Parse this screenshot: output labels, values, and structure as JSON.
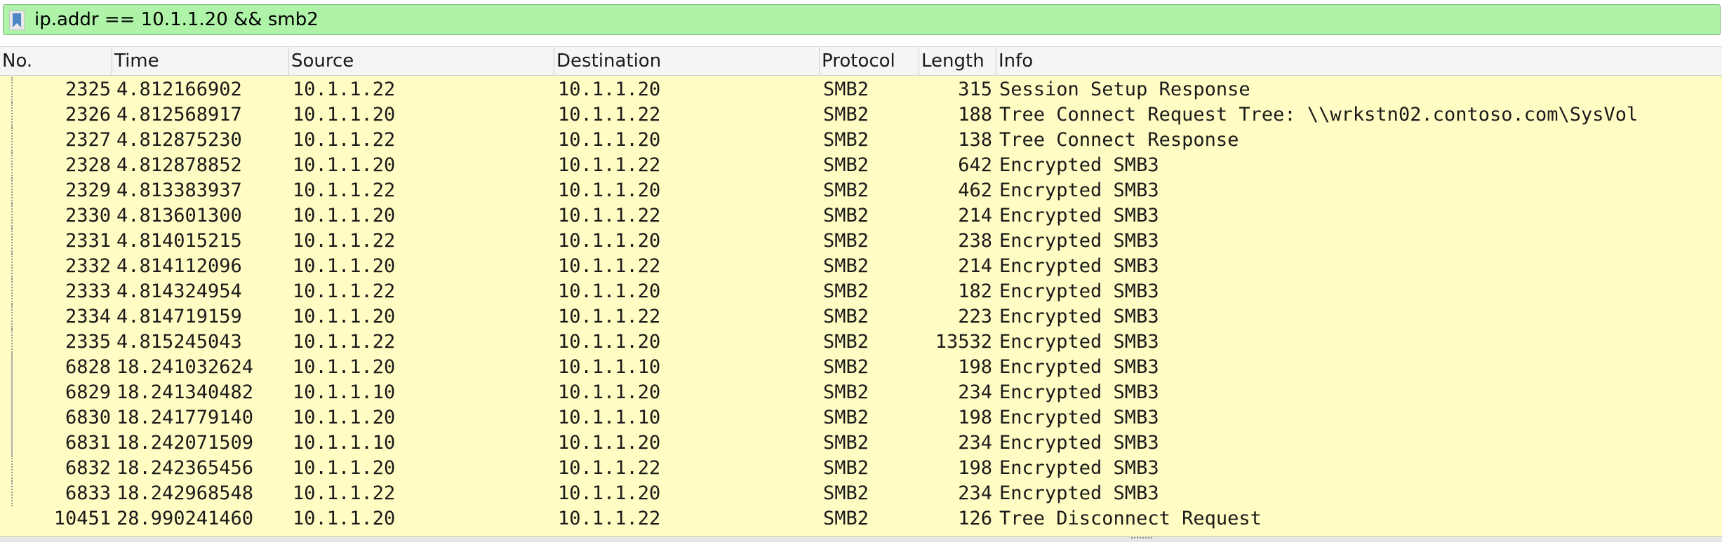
{
  "filter": {
    "value": "ip.addr == 10.1.1.20 && smb2",
    "bookmark_icon": "bookmark-icon",
    "background_color": "#aff3a8"
  },
  "columns": {
    "no": "No.",
    "time": "Time",
    "source": "Source",
    "destination": "Destination",
    "protocol": "Protocol",
    "length": "Length",
    "info": "Info"
  },
  "packets": [
    {
      "no": "2325",
      "time": "4.812166902",
      "source": "10.1.1.22",
      "destination": "10.1.1.20",
      "protocol": "SMB2",
      "length": "315",
      "info": "Session Setup Response"
    },
    {
      "no": "2326",
      "time": "4.812568917",
      "source": "10.1.1.20",
      "destination": "10.1.1.22",
      "protocol": "SMB2",
      "length": "188",
      "info": "Tree Connect Request Tree: \\\\wrkstn02.contoso.com\\SysVol"
    },
    {
      "no": "2327",
      "time": "4.812875230",
      "source": "10.1.1.22",
      "destination": "10.1.1.20",
      "protocol": "SMB2",
      "length": "138",
      "info": "Tree Connect Response"
    },
    {
      "no": "2328",
      "time": "4.812878852",
      "source": "10.1.1.20",
      "destination": "10.1.1.22",
      "protocol": "SMB2",
      "length": "642",
      "info": "Encrypted SMB3"
    },
    {
      "no": "2329",
      "time": "4.813383937",
      "source": "10.1.1.22",
      "destination": "10.1.1.20",
      "protocol": "SMB2",
      "length": "462",
      "info": "Encrypted SMB3"
    },
    {
      "no": "2330",
      "time": "4.813601300",
      "source": "10.1.1.20",
      "destination": "10.1.1.22",
      "protocol": "SMB2",
      "length": "214",
      "info": "Encrypted SMB3"
    },
    {
      "no": "2331",
      "time": "4.814015215",
      "source": "10.1.1.22",
      "destination": "10.1.1.20",
      "protocol": "SMB2",
      "length": "238",
      "info": "Encrypted SMB3"
    },
    {
      "no": "2332",
      "time": "4.814112096",
      "source": "10.1.1.20",
      "destination": "10.1.1.22",
      "protocol": "SMB2",
      "length": "214",
      "info": "Encrypted SMB3"
    },
    {
      "no": "2333",
      "time": "4.814324954",
      "source": "10.1.1.22",
      "destination": "10.1.1.20",
      "protocol": "SMB2",
      "length": "182",
      "info": "Encrypted SMB3"
    },
    {
      "no": "2334",
      "time": "4.814719159",
      "source": "10.1.1.20",
      "destination": "10.1.1.22",
      "protocol": "SMB2",
      "length": "223",
      "info": "Encrypted SMB3"
    },
    {
      "no": "2335",
      "time": "4.815245043",
      "source": "10.1.1.22",
      "destination": "10.1.1.20",
      "protocol": "SMB2",
      "length": "13532",
      "info": "Encrypted SMB3"
    },
    {
      "no": "6828",
      "time": "18.241032624",
      "source": "10.1.1.20",
      "destination": "10.1.1.10",
      "protocol": "SMB2",
      "length": "198",
      "info": "Encrypted SMB3"
    },
    {
      "no": "6829",
      "time": "18.241340482",
      "source": "10.1.1.10",
      "destination": "10.1.1.20",
      "protocol": "SMB2",
      "length": "234",
      "info": "Encrypted SMB3"
    },
    {
      "no": "6830",
      "time": "18.241779140",
      "source": "10.1.1.20",
      "destination": "10.1.1.10",
      "protocol": "SMB2",
      "length": "198",
      "info": "Encrypted SMB3"
    },
    {
      "no": "6831",
      "time": "18.242071509",
      "source": "10.1.1.10",
      "destination": "10.1.1.20",
      "protocol": "SMB2",
      "length": "234",
      "info": "Encrypted SMB3"
    },
    {
      "no": "6832",
      "time": "18.242365456",
      "source": "10.1.1.20",
      "destination": "10.1.1.22",
      "protocol": "SMB2",
      "length": "198",
      "info": "Encrypted SMB3"
    },
    {
      "no": "6833",
      "time": "18.242968548",
      "source": "10.1.1.22",
      "destination": "10.1.1.20",
      "protocol": "SMB2",
      "length": "234",
      "info": "Encrypted SMB3"
    },
    {
      "no": "10451",
      "time": "28.990241460",
      "source": "10.1.1.20",
      "destination": "10.1.1.22",
      "protocol": "SMB2",
      "length": "126",
      "info": "Tree Disconnect Request"
    }
  ],
  "row_color": "#fffdc4",
  "gutter_styles": [
    "dotted",
    "dotted",
    "dotted",
    "dotted",
    "dotted",
    "dotted",
    "dotted",
    "dotted",
    "dotted",
    "dotted",
    "dotted",
    "solid",
    "solid",
    "solid",
    "solid",
    "dotted",
    "dotted",
    "none"
  ]
}
